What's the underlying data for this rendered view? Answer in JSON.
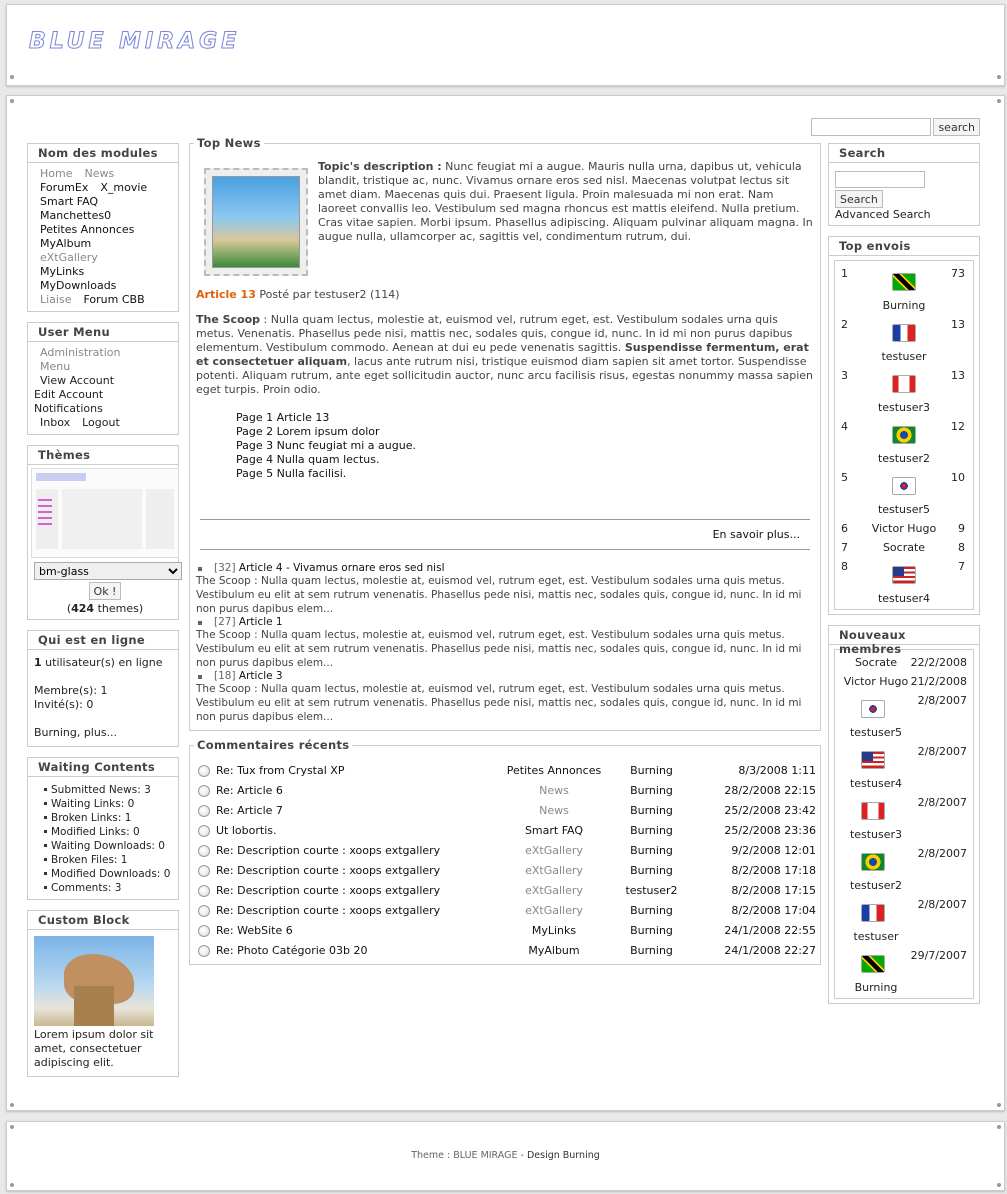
{
  "header": {
    "logo": "BLUE MIRAGE"
  },
  "search_top": {
    "placeholder": "",
    "button": "search"
  },
  "left": {
    "modules": {
      "title": "Nom des modules",
      "items": [
        {
          "label": "Home",
          "style": "grey"
        },
        {
          "label": "News",
          "style": "grey"
        },
        {
          "label": "ForumEx",
          "style": "black"
        },
        {
          "label": "X_movie",
          "style": "black"
        },
        {
          "label": "Smart FAQ",
          "style": "black"
        },
        {
          "label": "Manchettes0",
          "style": "black"
        },
        {
          "label": "Petites Annonces",
          "style": "black"
        },
        {
          "label": "MyAlbum",
          "style": "black"
        },
        {
          "label": "eXtGallery",
          "style": "grey"
        },
        {
          "label": "MyLinks",
          "style": "black"
        },
        {
          "label": "MyDownloads",
          "style": "black"
        },
        {
          "label": "Liaise",
          "style": "grey"
        },
        {
          "label": "Forum CBB",
          "style": "black"
        }
      ]
    },
    "usermenu": {
      "title": "User Menu",
      "admin": "Administration Menu",
      "view": "View Account",
      "edit": "Edit Account",
      "notif": "Notifications",
      "inbox": "Inbox",
      "logout": "Logout"
    },
    "themes": {
      "title": "Thèmes",
      "selected": "bm-glass",
      "ok": "Ok !",
      "count": "424",
      "count_suffix": " themes)",
      "count_prefix": "("
    },
    "online": {
      "title": "Qui est en ligne",
      "count": "1",
      "count_text": " utilisateur(s) en ligne",
      "members": "Membre(s): 1",
      "guests": "Invité(s): 0",
      "who": "Burning, plus..."
    },
    "waiting": {
      "title": "Waiting Contents",
      "items": [
        {
          "label": "Submitted News:",
          "val": "3"
        },
        {
          "label": "Waiting Links:",
          "val": "0"
        },
        {
          "label": "Broken Links:",
          "val": "1"
        },
        {
          "label": "Modified Links:",
          "val": "0"
        },
        {
          "label": "Waiting Downloads:",
          "val": "0"
        },
        {
          "label": "Broken Files:",
          "val": "1"
        },
        {
          "label": "Modified Downloads:",
          "val": "0"
        },
        {
          "label": "Comments:",
          "val": "3"
        }
      ]
    },
    "custom": {
      "title": "Custom Block",
      "text": "Lorem ipsum dolor sit amet, consectetuer adipiscing elit."
    }
  },
  "center": {
    "topnews": {
      "title": "Top News",
      "desc_label": "Topic's description :",
      "desc": "Nunc feugiat mi a augue. Mauris nulla urna, dapibus ut, vehicula blandit, tristique ac, nunc. Vivamus ornare eros sed nisl. Maecenas volutpat lectus sit amet diam. Maecenas quis dui. Praesent ligula. Proin malesuada mi non erat. Nam laoreet convallis leo. Vestibulum sed magna rhoncus est mattis eleifend. Nulla pretium. Cras vitae sapien. Morbi ipsum. Phasellus adipiscing. Aliquam pulvinar aliquam magna. In augue nulla, ullamcorper ac, sagittis vel, condimentum rutrum, dui.",
      "art_link": "Article 13",
      "art_meta": " Posté par testuser2 (114)",
      "scoop_label": "The Scoop",
      "scoop1": " : Nulla quam lectus, molestie at, euismod vel, rutrum eget, est. Vestibulum sodales urna quis metus. Venenatis. Phasellus pede nisi, mattis nec, sodales quis, congue id, nunc. In id mi non purus dapibus elementum. Vestibulum commodo. Aenean at dui eu pede venenatis sagittis. ",
      "scoop_bold": "Suspendisse fermentum, erat et consectetuer aliquam",
      "scoop2": ", lacus ante rutrum nisi, tristique euismod diam sapien sit amet tortor. Suspendisse potenti. Aliquam rutrum, ante eget sollicitudin auctor, nunc arcu facilisis risus, egestas nonummy massa sapien eget turpis. Proin odio.",
      "pages": [
        "Page 1 Article 13",
        "Page 2 Lorem ipsum dolor",
        "Page 3 Nunc feugiat mi a augue.",
        "Page 4 Nulla quam lectus.",
        "Page 5 Nulla facilisi."
      ],
      "more": "En savoir plus...",
      "others": [
        {
          "num": "[32]",
          "title": "Article 4 - Vivamus ornare eros sed nisl",
          "text": "The Scoop : Nulla quam lectus, molestie at, euismod vel, rutrum eget, est. Vestibulum sodales urna quis metus. Vestibulum eu elit at sem rutrum venenatis. Phasellus pede nisi, mattis nec, sodales quis, congue id, nunc. In id mi non purus dapibus elem..."
        },
        {
          "num": "[27]",
          "title": "Article 1",
          "text": "The Scoop : Nulla quam lectus, molestie at, euismod vel, rutrum eget, est. Vestibulum sodales urna quis metus. Vestibulum eu elit at sem rutrum venenatis. Phasellus pede nisi, mattis nec, sodales quis, congue id, nunc. In id mi non purus dapibus elem..."
        },
        {
          "num": "[18]",
          "title": "Article 3",
          "text": "The Scoop : Nulla quam lectus, molestie at, euismod vel, rutrum eget, est. Vestibulum sodales urna quis metus. Vestibulum eu elit at sem rutrum venenatis. Phasellus pede nisi, mattis nec, sodales quis, congue id, nunc. In id mi non purus dapibus elem..."
        }
      ]
    },
    "comments": {
      "title": "Commentaires récents",
      "rows": [
        {
          "t": "Re: Tux from Crystal XP",
          "m": "Petites Annonces",
          "mg": false,
          "u": "Burning",
          "d": "8/3/2008 1:11"
        },
        {
          "t": "Re: Article 6",
          "m": "News",
          "mg": true,
          "u": "Burning",
          "d": "28/2/2008 22:15"
        },
        {
          "t": "Re: Article 7",
          "m": "News",
          "mg": true,
          "u": "Burning",
          "d": "25/2/2008 23:42"
        },
        {
          "t": "Ut lobortis.",
          "m": "Smart FAQ",
          "mg": false,
          "u": "Burning",
          "d": "25/2/2008 23:36"
        },
        {
          "t": "Re: Description courte : xoops extgallery",
          "m": "eXtGallery",
          "mg": true,
          "u": "Burning",
          "d": "9/2/2008 12:01"
        },
        {
          "t": "Re: Description courte : xoops extgallery",
          "m": "eXtGallery",
          "mg": true,
          "u": "Burning",
          "d": "8/2/2008 17:18"
        },
        {
          "t": "Re: Description courte : xoops extgallery",
          "m": "eXtGallery",
          "mg": true,
          "u": "testuser2",
          "d": "8/2/2008 17:15"
        },
        {
          "t": "Re: Description courte : xoops extgallery",
          "m": "eXtGallery",
          "mg": true,
          "u": "Burning",
          "d": "8/2/2008 17:04"
        },
        {
          "t": "Re: WebSite 6",
          "m": "MyLinks",
          "mg": false,
          "u": "Burning",
          "d": "24/1/2008 22:55"
        },
        {
          "t": "Re: Photo Catégorie 03b 20",
          "m": "MyAlbum",
          "mg": false,
          "u": "Burning",
          "d": "24/1/2008 22:27"
        }
      ]
    }
  },
  "right": {
    "search": {
      "title": "Search",
      "button": "Search",
      "advanced": "Advanced Search"
    },
    "topenvois": {
      "title": "Top envois",
      "rows": [
        {
          "n": "1",
          "c": "73",
          "u": "Burning",
          "flag": "f-jm"
        },
        {
          "n": "2",
          "c": "13",
          "u": "testuser",
          "flag": "f-fr"
        },
        {
          "n": "3",
          "c": "13",
          "u": "testuser3",
          "flag": "f-ca"
        },
        {
          "n": "4",
          "c": "12",
          "u": "testuser2",
          "flag": "f-br"
        },
        {
          "n": "5",
          "c": "10",
          "u": "testuser5",
          "flag": "f-kr"
        },
        {
          "n": "6",
          "c": "9",
          "u": "Victor Hugo",
          "flag": ""
        },
        {
          "n": "7",
          "c": "8",
          "u": "Socrate",
          "flag": ""
        },
        {
          "n": "8",
          "c": "7",
          "u": "testuser4",
          "flag": "f-us"
        }
      ]
    },
    "newmembers": {
      "title": "Nouveaux membres",
      "rows": [
        {
          "u": "Socrate",
          "d": "22/2/2008",
          "flag": ""
        },
        {
          "u": "Victor Hugo",
          "d": "21/2/2008",
          "flag": ""
        },
        {
          "u": "testuser5",
          "d": "2/8/2007",
          "flag": "f-kr"
        },
        {
          "u": "testuser4",
          "d": "2/8/2007",
          "flag": "f-us"
        },
        {
          "u": "testuser3",
          "d": "2/8/2007",
          "flag": "f-ca"
        },
        {
          "u": "testuser2",
          "d": "2/8/2007",
          "flag": "f-br"
        },
        {
          "u": "testuser",
          "d": "2/8/2007",
          "flag": "f-fr"
        },
        {
          "u": "Burning",
          "d": "29/7/2007",
          "flag": "f-jm"
        }
      ]
    }
  },
  "footer": {
    "prefix": "Theme : ",
    "theme": "BLUE MIRAGE",
    "sep": " - ",
    "design": "Design Burning"
  }
}
